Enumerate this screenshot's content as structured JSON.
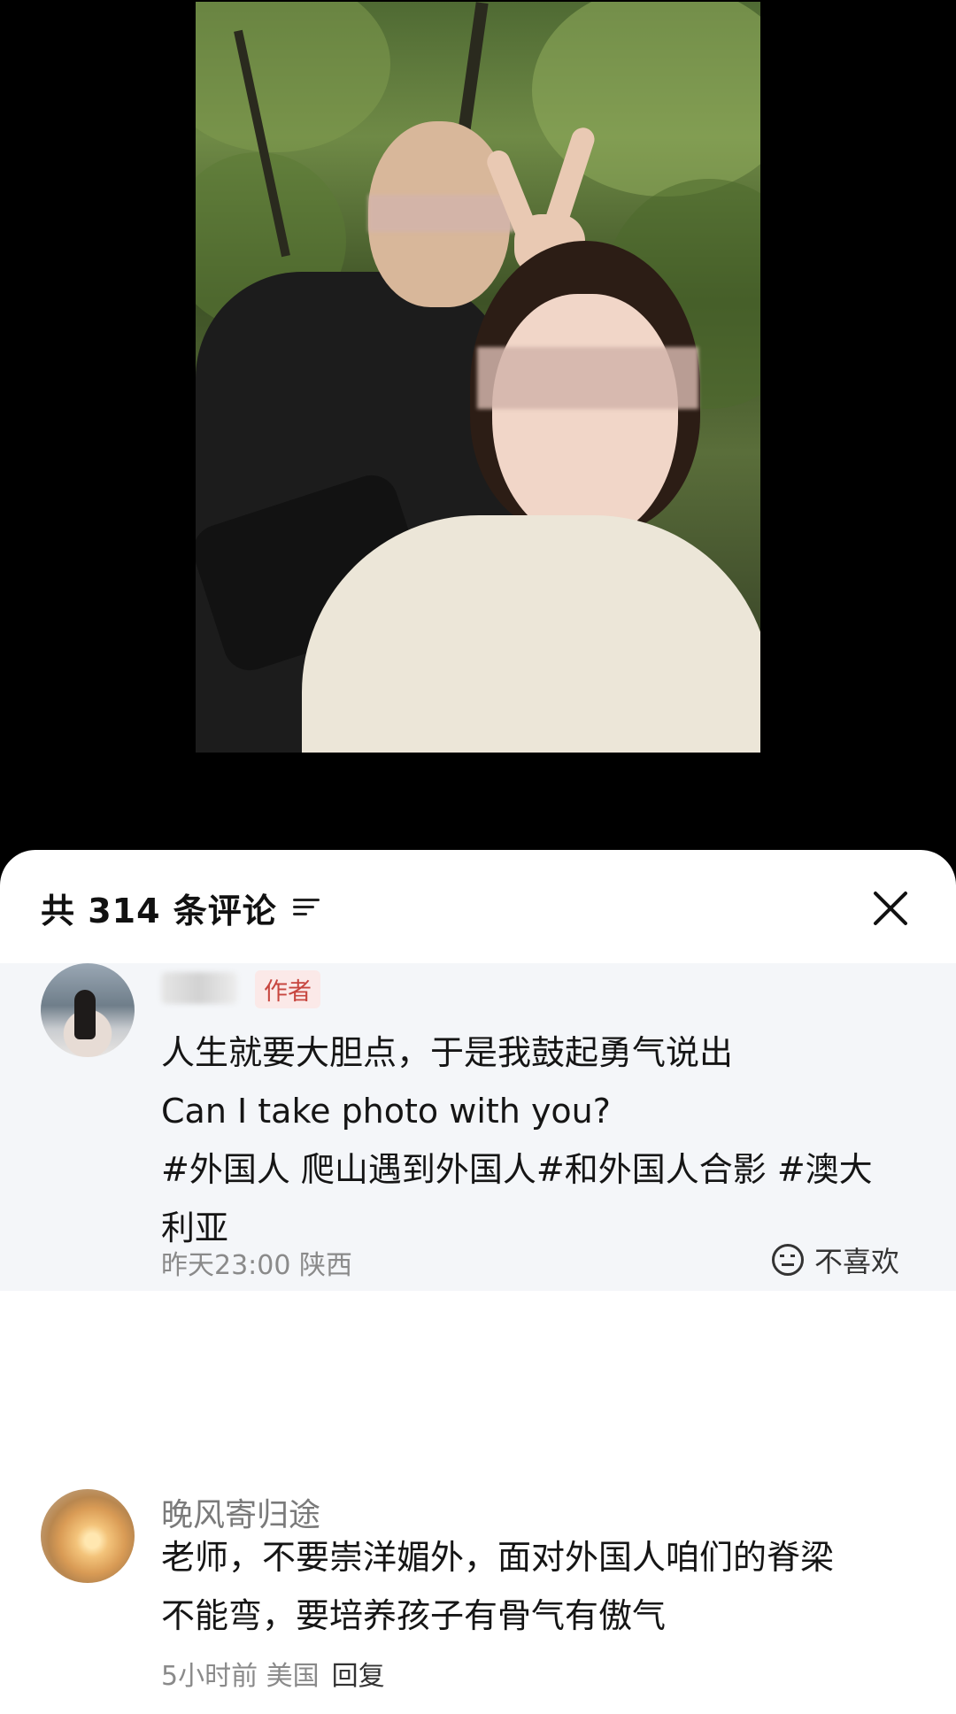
{
  "comments_panel": {
    "title": "共 314 条评论",
    "sort_icon": "sort-lines-icon",
    "close_icon": "close-x-icon"
  },
  "author_comment": {
    "badge": "作者",
    "lines": [
      "人生就要大胆点，于是我鼓起勇气说出",
      "Can I take photo with you?",
      "#外国人 爬山遇到外国人#和外国人合影 #澳大",
      "利亚"
    ],
    "meta": "昨天23:00  陕西",
    "dislike_label": "不喜欢",
    "dislike_icon": "neutral-face-icon"
  },
  "comment_2": {
    "username": "晚风寄归途",
    "lines": [
      "老师，不要崇洋媚外，面对外国人咱们的脊梁",
      "不能弯，要培养孩子有骨气有傲气"
    ],
    "meta": "5小时前  美国",
    "reply_label": "回复"
  }
}
